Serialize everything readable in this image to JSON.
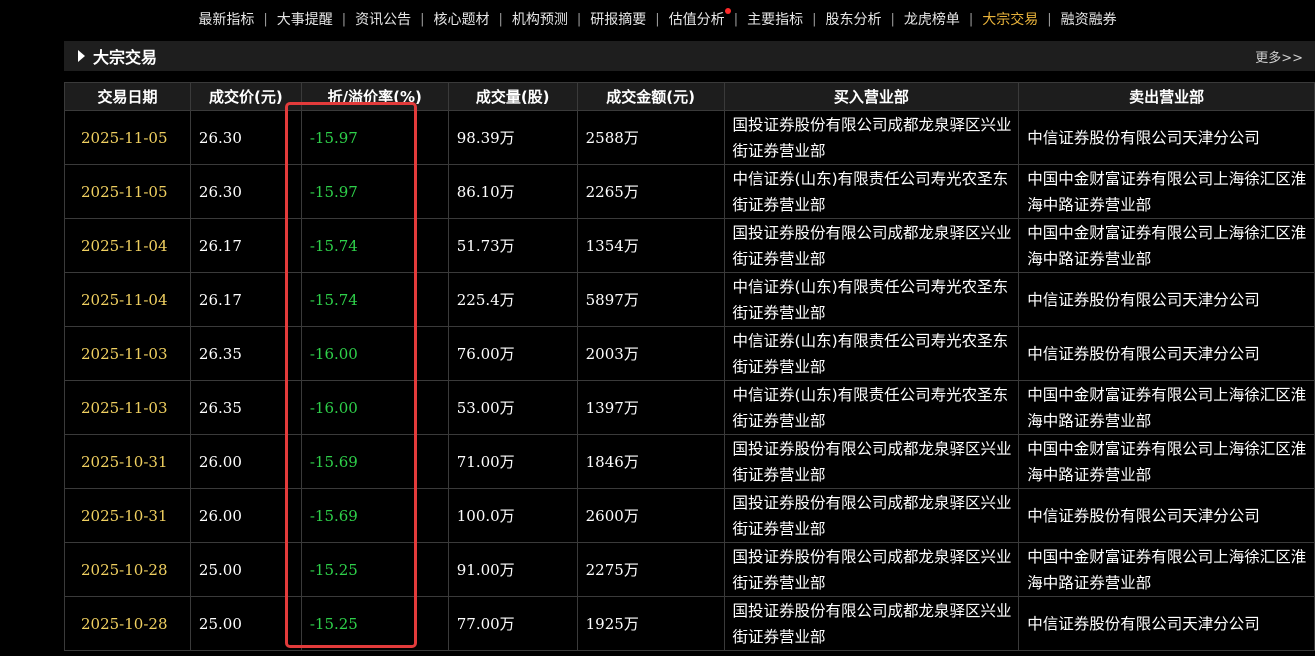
{
  "nav": {
    "items": [
      {
        "label": "最新指标",
        "active": false,
        "dot": false
      },
      {
        "label": "大事提醒",
        "active": false,
        "dot": false
      },
      {
        "label": "资讯公告",
        "active": false,
        "dot": false
      },
      {
        "label": "核心题材",
        "active": false,
        "dot": false
      },
      {
        "label": "机构预测",
        "active": false,
        "dot": false
      },
      {
        "label": "研报摘要",
        "active": false,
        "dot": false
      },
      {
        "label": "估值分析",
        "active": false,
        "dot": true
      },
      {
        "label": "主要指标",
        "active": false,
        "dot": false
      },
      {
        "label": "股东分析",
        "active": false,
        "dot": false
      },
      {
        "label": "龙虎榜单",
        "active": false,
        "dot": false
      },
      {
        "label": "大宗交易",
        "active": true,
        "dot": false
      },
      {
        "label": "融资融券",
        "active": false,
        "dot": false
      }
    ],
    "separator": "|"
  },
  "section": {
    "title": "大宗交易",
    "more_label": "更多>>"
  },
  "table": {
    "headers": [
      "交易日期",
      "成交价(元)",
      "折/溢价率(%)",
      "成交量(股)",
      "成交金额(元)",
      "买入营业部",
      "卖出营业部"
    ],
    "rows": [
      [
        "2025-11-05",
        "26.30",
        "-15.97",
        "98.39万",
        "2588万",
        "国投证券股份有限公司成都龙泉驿区兴业街证券营业部",
        "中信证券股份有限公司天津分公司"
      ],
      [
        "2025-11-05",
        "26.30",
        "-15.97",
        "86.10万",
        "2265万",
        "中信证券(山东)有限责任公司寿光农圣东街证券营业部",
        "中国中金财富证券有限公司上海徐汇区淮海中路证券营业部"
      ],
      [
        "2025-11-04",
        "26.17",
        "-15.74",
        "51.73万",
        "1354万",
        "国投证券股份有限公司成都龙泉驿区兴业街证券营业部",
        "中国中金财富证券有限公司上海徐汇区淮海中路证券营业部"
      ],
      [
        "2025-11-04",
        "26.17",
        "-15.74",
        "225.4万",
        "5897万",
        "中信证券(山东)有限责任公司寿光农圣东街证券营业部",
        "中信证券股份有限公司天津分公司"
      ],
      [
        "2025-11-03",
        "26.35",
        "-16.00",
        "76.00万",
        "2003万",
        "中信证券(山东)有限责任公司寿光农圣东街证券营业部",
        "中信证券股份有限公司天津分公司"
      ],
      [
        "2025-11-03",
        "26.35",
        "-16.00",
        "53.00万",
        "1397万",
        "中信证券(山东)有限责任公司寿光农圣东街证券营业部",
        "中国中金财富证券有限公司上海徐汇区淮海中路证券营业部"
      ],
      [
        "2025-10-31",
        "26.00",
        "-15.69",
        "71.00万",
        "1846万",
        "国投证券股份有限公司成都龙泉驿区兴业街证券营业部",
        "中国中金财富证券有限公司上海徐汇区淮海中路证券营业部"
      ],
      [
        "2025-10-31",
        "26.00",
        "-15.69",
        "100.0万",
        "2600万",
        "国投证券股份有限公司成都龙泉驿区兴业街证券营业部",
        "中信证券股份有限公司天津分公司"
      ],
      [
        "2025-10-28",
        "25.00",
        "-15.25",
        "91.00万",
        "2275万",
        "国投证券股份有限公司成都龙泉驿区兴业街证券营业部",
        "中国中金财富证券有限公司上海徐汇区淮海中路证券营业部"
      ],
      [
        "2025-10-28",
        "25.00",
        "-15.25",
        "77.00万",
        "1925万",
        "国投证券股份有限公司成都龙泉驿区兴业街证券营业部",
        "中信证券股份有限公司天津分公司"
      ]
    ]
  },
  "colors": {
    "background": "#000000",
    "active_tab": "#e8b23a",
    "date_text": "#f0d060",
    "negative_rate": "#2ed04a",
    "highlight_box": "#e23b3b",
    "notification_dot": "#ff2a2a"
  },
  "icons": {
    "section_arrow": "triangle-right-icon",
    "notification": "red-dot-icon"
  }
}
